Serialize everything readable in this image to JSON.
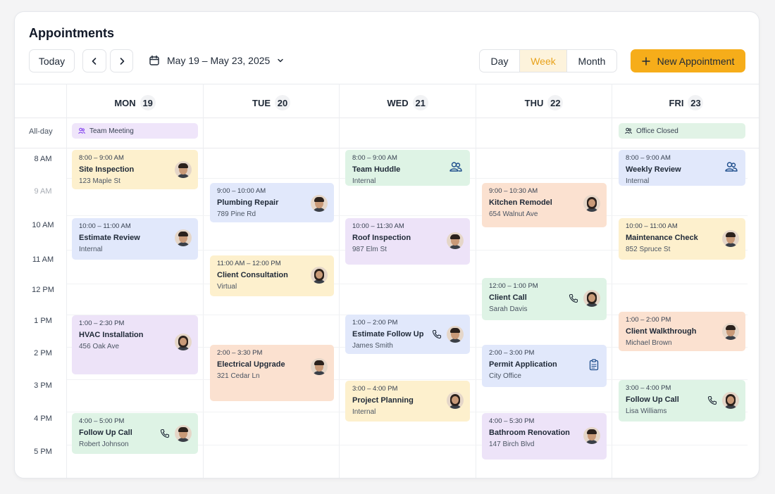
{
  "header": {
    "title": "Appointments"
  },
  "toolbar": {
    "today_label": "Today",
    "prev_icon": "chevron-left-icon",
    "next_icon": "chevron-right-icon",
    "date_range": "May 19 – May 23, 2025",
    "views": [
      "Day",
      "Week",
      "Month"
    ],
    "active_view": "Week",
    "new_label": "New Appointment",
    "accent_color": "#f6ad1a"
  },
  "days": [
    {
      "name": "MON",
      "num": "19"
    },
    {
      "name": "TUE",
      "num": "20"
    },
    {
      "name": "WED",
      "num": "21"
    },
    {
      "name": "THU",
      "num": "22"
    },
    {
      "name": "FRI",
      "num": "23"
    }
  ],
  "allday": {
    "label": "All-day",
    "events": [
      {
        "day": 0,
        "title": "Team Meeting",
        "color": "#efe5fa"
      },
      {
        "day": 4,
        "title": "Office Closed",
        "color": "#e1f3e6"
      }
    ]
  },
  "time_labels": [
    "8 AM",
    "9 AM",
    "10 AM",
    "11 AM",
    "12 PM",
    "1 PM",
    "2 PM",
    "3 PM",
    "4 PM",
    "5 PM"
  ],
  "events": {
    "mon": [
      {
        "time": "8:00 – 9:00 AM",
        "title": "Site Inspection",
        "sub": "123 Maple St"
      },
      {
        "time": "10:00 – 11:00 AM",
        "title": "Estimate Review",
        "sub": "Internal"
      },
      {
        "time": "1:00 – 2:30 PM",
        "title": "HVAC Installation",
        "sub": "456 Oak Ave"
      },
      {
        "time": "4:00 – 5:00 PM",
        "title": "Follow Up Call",
        "sub": "Robert Johnson"
      }
    ],
    "tue": [
      {
        "time": "9:00 – 10:00 AM",
        "title": "Plumbing Repair",
        "sub": "789 Pine Rd"
      },
      {
        "time": "11:00 AM – 12:00 PM",
        "title": "Client Consultation",
        "sub": "Virtual"
      },
      {
        "time": "2:00 – 3:30 PM",
        "title": "Electrical Upgrade",
        "sub": "321 Cedar Ln"
      }
    ],
    "wed": [
      {
        "time": "8:00 – 9:00 AM",
        "title": "Team Huddle",
        "sub": "Internal"
      },
      {
        "time": "10:00 – 11:30 AM",
        "title": "Roof Inspection",
        "sub": "987 Elm St"
      },
      {
        "time": "1:00 – 2:00 PM",
        "title": "Estimate Follow Up",
        "sub": "James Smith"
      },
      {
        "time": "3:00 – 4:00 PM",
        "title": "Project Planning",
        "sub": "Internal"
      }
    ],
    "thu": [
      {
        "time": "9:00 – 10:30 AM",
        "title": "Kitchen Remodel",
        "sub": "654 Walnut Ave"
      },
      {
        "time": "12:00 – 1:00 PM",
        "title": "Client Call",
        "sub": "Sarah Davis"
      },
      {
        "time": "2:00 – 3:00 PM",
        "title": "Permit Application",
        "sub": "City Office"
      },
      {
        "time": "4:00 – 5:30 PM",
        "title": "Bathroom Renovation",
        "sub": "147 Birch Blvd"
      }
    ],
    "fri": [
      {
        "time": "8:00 – 9:00 AM",
        "title": "Weekly Review",
        "sub": "Internal"
      },
      {
        "time": "10:00 – 11:00 AM",
        "title": "Maintenance Check",
        "sub": "852 Spruce St"
      },
      {
        "time": "1:00 – 2:00 PM",
        "title": "Client Walkthrough",
        "sub": "Michael Brown"
      },
      {
        "time": "3:00 – 4:00 PM",
        "title": "Follow Up Call",
        "sub": "Lisa Williams"
      }
    ]
  },
  "colors": {
    "yellow": "#fdf0cd",
    "blue": "#e1e8fb",
    "purple": "#ede3f8",
    "green": "#def3e5",
    "orange": "#fbe1d0"
  }
}
